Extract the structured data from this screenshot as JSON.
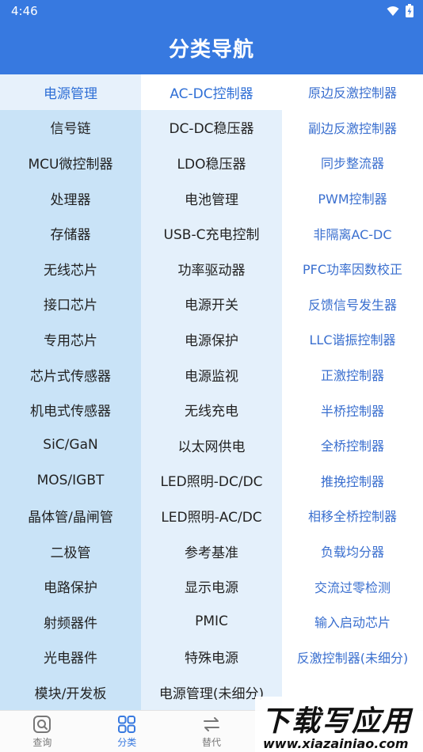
{
  "status": {
    "time": "4:46"
  },
  "header": {
    "title": "分类导航"
  },
  "col1": [
    "电源管理",
    "信号链",
    "MCU微控制器",
    "处理器",
    "存储器",
    "无线芯片",
    "接口芯片",
    "专用芯片",
    "芯片式传感器",
    "机电式传感器",
    "SiC/GaN",
    "MOS/IGBT",
    "晶体管/晶闸管",
    "二极管",
    "电路保护",
    "射频器件",
    "光电器件",
    "模块/开发板"
  ],
  "col2": [
    "AC-DC控制器",
    "DC-DC稳压器",
    "LDO稳压器",
    "电池管理",
    "USB-C充电控制",
    "功率驱动器",
    "电源开关",
    "电源保护",
    "电源监视",
    "无线充电",
    "以太网供电",
    "LED照明-DC/DC",
    "LED照明-AC/DC",
    "参考基准",
    "显示电源",
    "PMIC",
    "特殊电源",
    "电源管理(未细分)"
  ],
  "col3": [
    "原边反激控制器",
    "副边反激控制器",
    "同步整流器",
    "PWM控制器",
    "非隔离AC-DC",
    "PFC功率因数校正",
    "反馈信号发生器",
    "LLC谐振控制器",
    "正激控制器",
    "半桥控制器",
    "全桥控制器",
    "推挽控制器",
    "相移全桥控制器",
    "负载均分器",
    "交流过零检测",
    "输入启动芯片",
    "反激控制器(未细分)"
  ],
  "nav": {
    "tab1": "查询",
    "tab2": "分类",
    "tab3": "替代"
  },
  "watermark": {
    "big": "下载写应用",
    "small": "www.xiazainiao.com"
  },
  "colors": {
    "primary": "#3779e0",
    "col1_bg": "#c9e3f7",
    "col2_bg": "#e4f0fb",
    "link": "#3a6fcf"
  }
}
